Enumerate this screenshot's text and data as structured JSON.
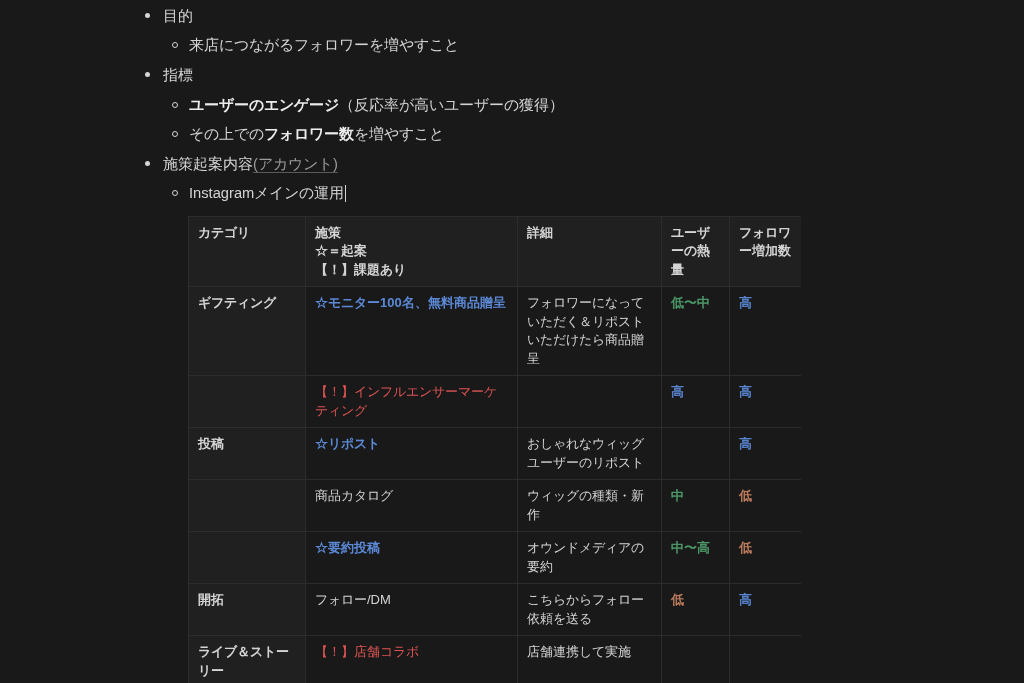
{
  "list": [
    {
      "text": "目的",
      "cursor": false,
      "children": [
        {
          "text": "来店につながるフォロワーを増やすこと",
          "cursor": false
        }
      ]
    },
    {
      "text": "指標",
      "cursor": false,
      "children": [
        {
          "text": "**ユーザーのエンゲージ**（反応率が高いユーザーの獲得）",
          "cursor": false
        },
        {
          "text": "その上での**フォロワー数**を増やすこと",
          "cursor": false
        }
      ]
    },
    {
      "text": "施策起案内容",
      "link": "(アカウント)",
      "cursor": false,
      "children": [
        {
          "text": "Instagramメインの運用",
          "cursor": true
        }
      ]
    }
  ],
  "table": {
    "columns": [
      {
        "lines": [
          "カテゴリ"
        ]
      },
      {
        "lines": [
          "施策",
          "☆＝起案",
          "【！】課題あり"
        ]
      },
      {
        "lines": [
          "詳細"
        ]
      },
      {
        "lines": [
          "ユーザーの熱量"
        ]
      },
      {
        "lines": [
          "フォロワー増加数"
        ]
      }
    ],
    "rows": [
      {
        "category": "ギフティング",
        "measure": {
          "text": "☆モニター100名、無料商品贈呈",
          "kind": "proposal"
        },
        "detail": "フォロワーになっていただく＆リポストいただけたら商品贈呈",
        "user_engagement": {
          "text": "低〜中",
          "color": "#4f9e6c"
        },
        "follower_growth": {
          "text": "高",
          "color": "#5b89d6"
        }
      },
      {
        "measure": {
          "text": "【！】インフルエンサーマーケティング",
          "kind": "issue"
        },
        "user_engagement": {
          "text": "高",
          "color": "#5b89d6"
        },
        "follower_growth": {
          "text": "高",
          "color": "#5b89d6"
        }
      },
      {
        "category": "投稿",
        "measure": {
          "text": "☆リポスト",
          "kind": "proposal"
        },
        "detail": "おしゃれなウィッグユーザーのリポスト",
        "follower_growth": {
          "text": "高",
          "color": "#5b89d6"
        }
      },
      {
        "measure": {
          "text": "商品カタログ",
          "kind": "plain"
        },
        "detail": "ウィッグの種類・新作",
        "user_engagement": {
          "text": "中",
          "color": "#4f9e6c"
        },
        "follower_growth": {
          "text": "低",
          "color": "#c4805f"
        }
      },
      {
        "measure": {
          "text": "☆要約投稿",
          "kind": "proposal"
        },
        "detail": "オウンドメディアの要約",
        "user_engagement": {
          "text": "中〜高",
          "color": "#4f9e6c"
        },
        "follower_growth": {
          "text": "低",
          "color": "#c4805f"
        }
      },
      {
        "category": "開拓",
        "measure": {
          "text": "フォロー/DM",
          "kind": "plain"
        },
        "detail": "こちらからフォロー依頼を送る",
        "user_engagement": {
          "text": "低",
          "color": "#c4805f"
        },
        "follower_growth": {
          "text": "高",
          "color": "#5b89d6"
        }
      },
      {
        "category": "ライブ＆ストーリー",
        "measure": {
          "text": "【！】店舗コラボ",
          "kind": "issue"
        },
        "detail": "店舗連携して実施"
      }
    ]
  }
}
